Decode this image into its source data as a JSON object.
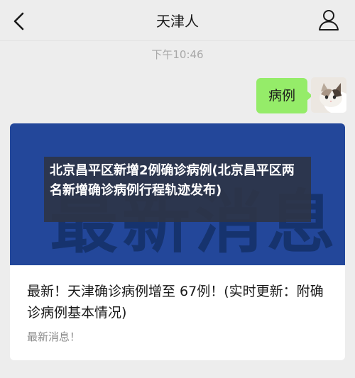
{
  "nav": {
    "title": "天津人"
  },
  "chat": {
    "timestamp": "下午10:46",
    "sent_message": "病例"
  },
  "article_card": {
    "overlay_title": "北京昌平区新增2例确诊病例(北京昌平区两名新增确诊病例行程轨迹发布)",
    "image_text": "最新消息",
    "image_bg_color": "#23479a",
    "description": "最新！天津确诊病例增至 67例！(实时更新：附确诊病例基本情况)",
    "source": "最新消息！"
  },
  "colors": {
    "bubble": "#95ec69",
    "background": "#ededed"
  },
  "icons": {
    "back": "chevron-left-icon",
    "profile": "person-icon"
  }
}
